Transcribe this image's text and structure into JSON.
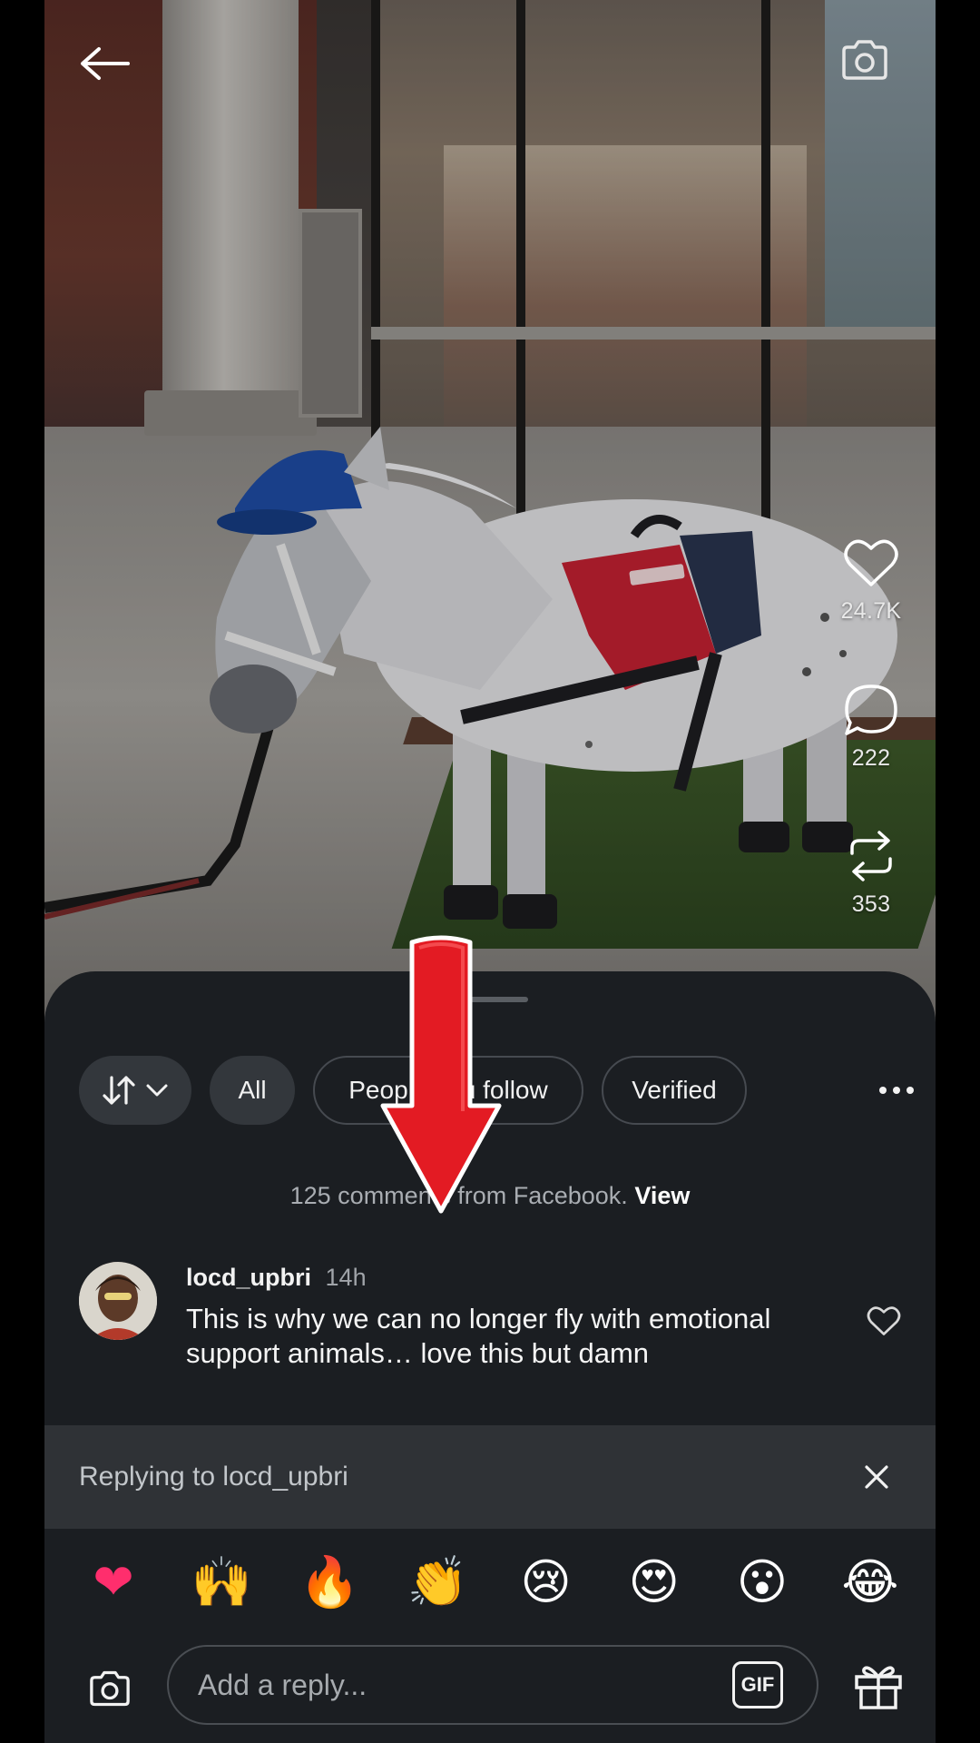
{
  "video": {
    "like_count": "24.7K",
    "comment_count": "222",
    "repost_count": "353"
  },
  "comments": {
    "filters": {
      "all_label": "All",
      "people_label": "People you follow",
      "verified_label": "Verified"
    },
    "facebook_note": {
      "text": "125 comments from Facebook.",
      "action": "View"
    },
    "items": [
      {
        "username": "locd_upbri",
        "time": "14h",
        "text": "This is why we can no longer fly with emotional support animals… love this but damn"
      }
    ]
  },
  "reply": {
    "replying_label": "Replying to locd_upbri",
    "placeholder": "Add a reply...",
    "gif_label": "GIF"
  },
  "quick_reactions": [
    "❤",
    "🙌",
    "🔥",
    "👏",
    "😢",
    "😍",
    "😮",
    "😂"
  ],
  "colors": {
    "sheet_background": "#1b1e22",
    "chip_filled": "#33373c",
    "reply_bar": "#2f3236",
    "overlay_arrow": "#e31b23"
  },
  "icons": {
    "back": "arrow-left-icon",
    "camera": "camera-icon",
    "like": "heart-icon",
    "comment": "speech-bubble-icon",
    "repost": "repost-icon",
    "sort": "sort-arrows-icon",
    "more": "more-dots-icon",
    "close": "close-icon",
    "gift": "gift-icon"
  }
}
